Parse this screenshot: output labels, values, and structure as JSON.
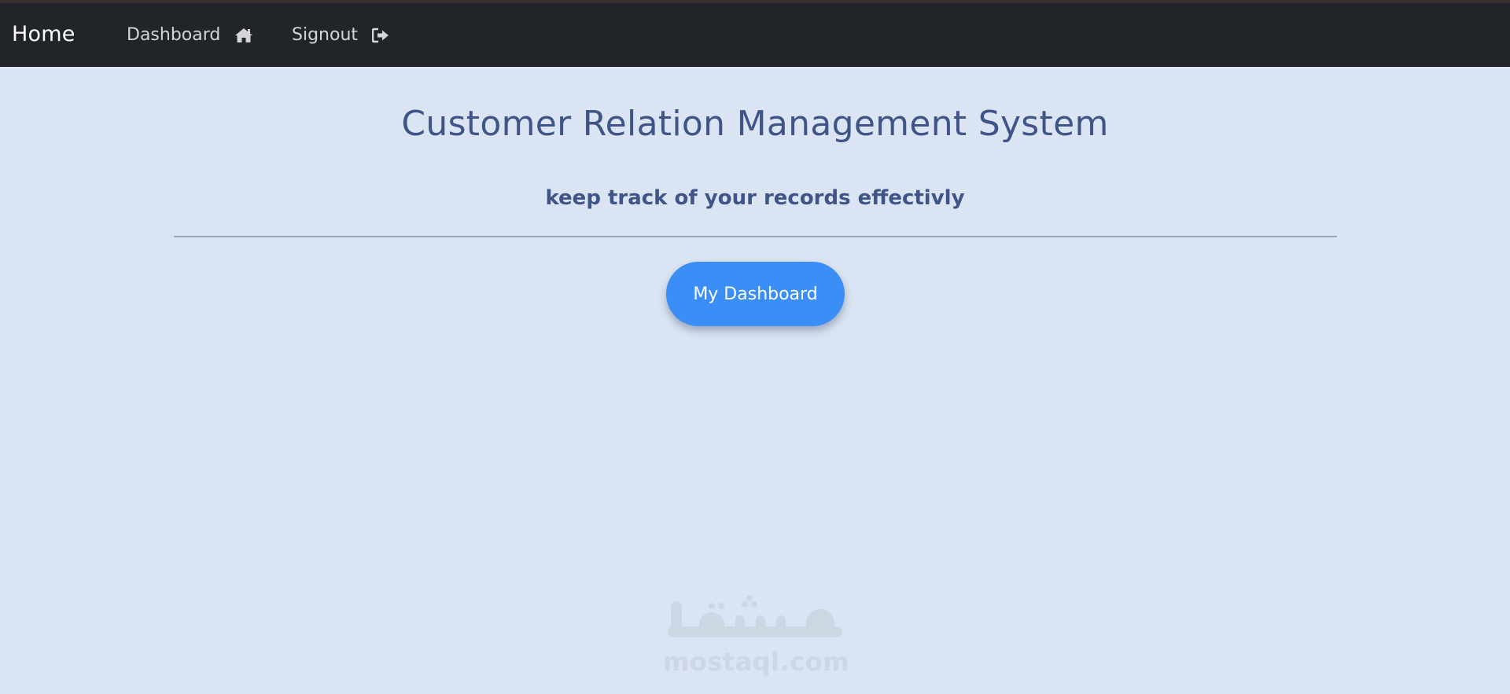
{
  "navbar": {
    "brand": "Home",
    "links": [
      {
        "label": "Dashboard",
        "icon": "home-icon"
      },
      {
        "label": "Signout",
        "icon": "sign-out-icon"
      }
    ],
    "background": "#212529"
  },
  "main": {
    "title": "Customer Relation Management System",
    "subtitle": "keep track of your records effectivly",
    "button_label": "My Dashboard",
    "accent": "#3a8ef5",
    "text_color": "#3f5487",
    "background": "#dae4f2"
  },
  "watermark": {
    "arabic": "مستقل",
    "latin": "mostaql.com"
  }
}
